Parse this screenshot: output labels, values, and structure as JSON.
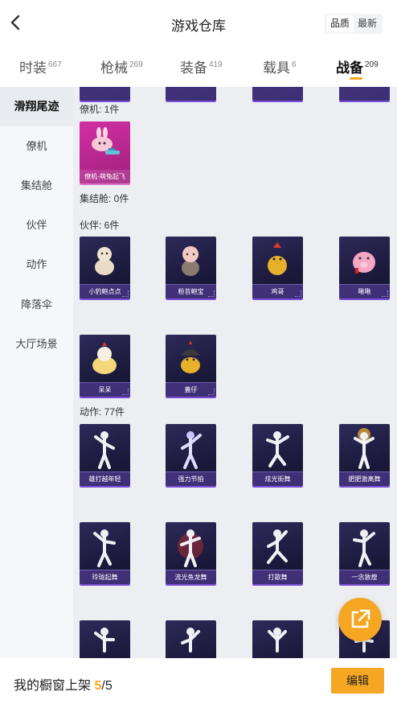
{
  "header": {
    "title": "游戏仓库",
    "sort_quality": "品质",
    "sort_latest": "最新"
  },
  "tabs": [
    {
      "label": "时装",
      "count": "667"
    },
    {
      "label": "枪械",
      "count": "269"
    },
    {
      "label": "装备",
      "count": "419"
    },
    {
      "label": "载具",
      "count": "6"
    },
    {
      "label": "战备",
      "count": "209"
    }
  ],
  "sidebar": [
    "滑翔尾迹",
    "僚机",
    "集结舱",
    "伙伴",
    "动作",
    "降落伞",
    "大厅场景"
  ],
  "sections": {
    "wingman": "僚机: 1件",
    "pod": "集结舱: 0件",
    "partner": "伙伴: 6件",
    "emote": "动作: 77件"
  },
  "items": {
    "wingman": [
      "僚机-萌兔起飞"
    ],
    "partner": [
      "小豹鲍点点",
      "粉苔鲍宝",
      "鸡哥",
      "啾啾",
      "呆呆",
      "蓋仔"
    ],
    "emote": [
      "雄打越年轻",
      "强力节拍",
      "炫光街舞",
      "肥肥激离舞",
      "玲珑起舞",
      "流光鱼龙舞",
      "打歌舞",
      "一念敦煌"
    ]
  },
  "footer": {
    "label": "我的橱窗上架",
    "current": "5",
    "total": "/5",
    "edit": "编辑"
  },
  "colors": {
    "accent": "#f5a623",
    "card_bg": "#1c1a3c",
    "card_edge": "#7a4fd8",
    "wingman_card": "#c02a98"
  },
  "icons": {
    "back": "chevron-left-icon",
    "share": "external-link-icon"
  }
}
